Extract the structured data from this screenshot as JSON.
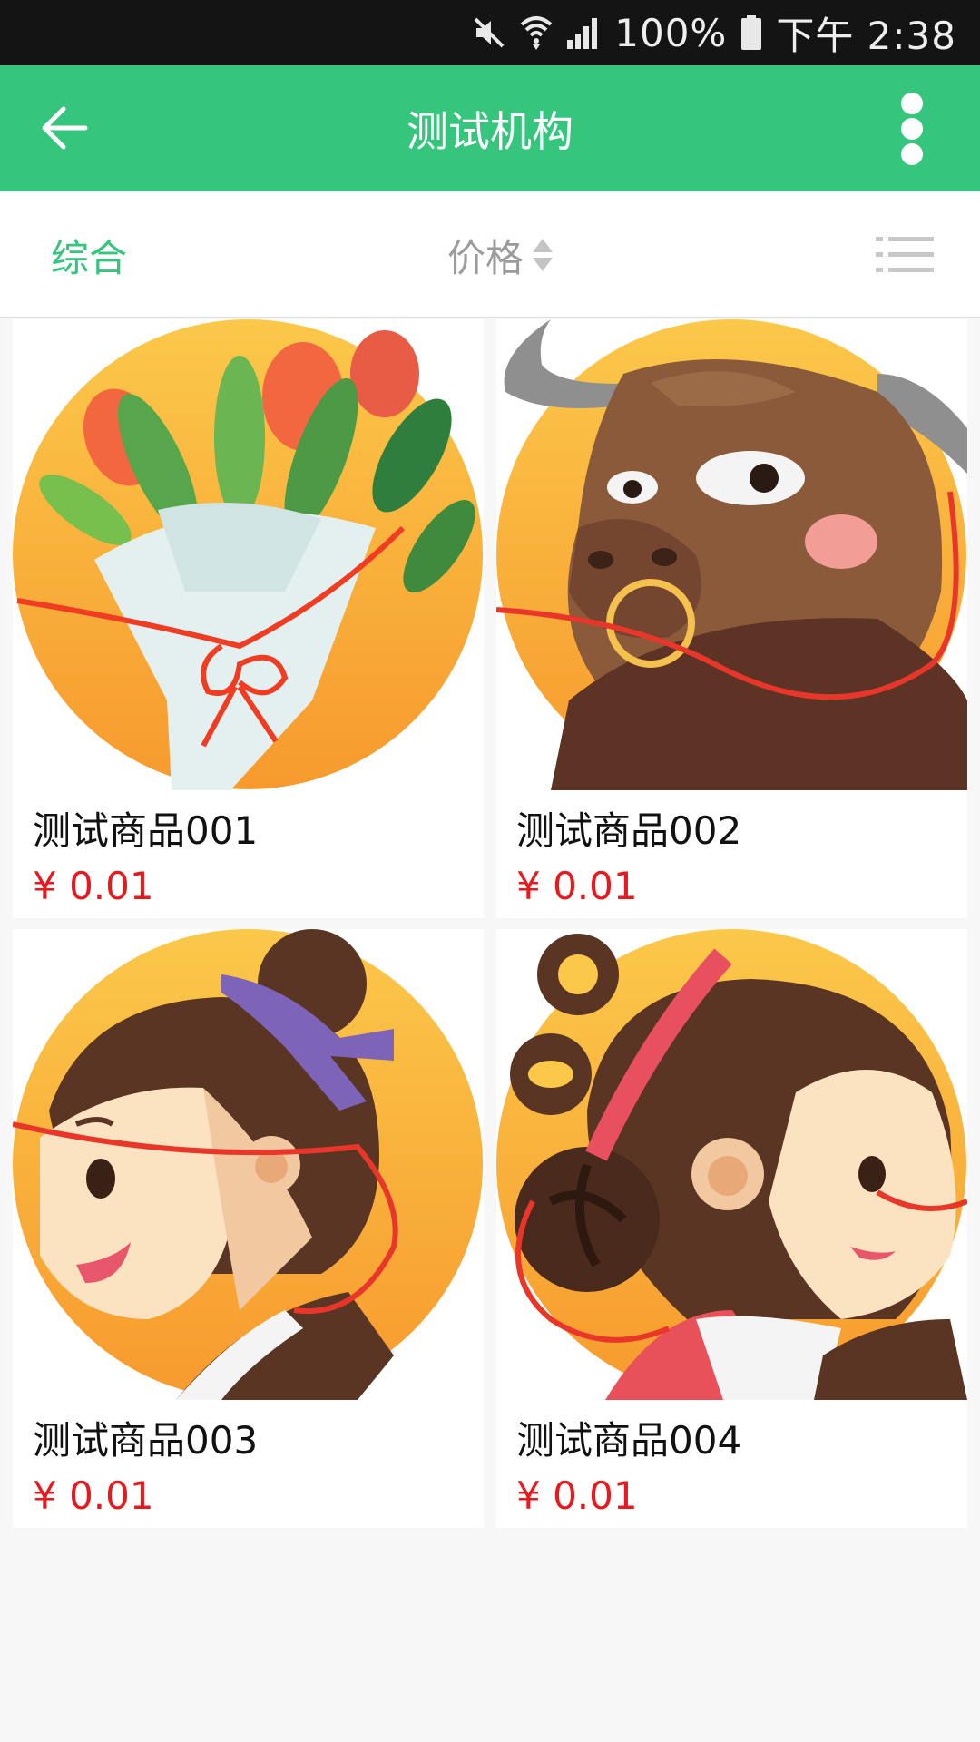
{
  "status_bar": {
    "battery": "100%",
    "time": "下午 2:38",
    "icons": [
      "mute-icon",
      "wifi-icon",
      "signal-icon",
      "battery-icon"
    ]
  },
  "app_bar": {
    "title": "测试机构",
    "back_icon": "arrow-left-icon",
    "menu_icon": "more-vertical-icon"
  },
  "sort_bar": {
    "comprehensive": "综合",
    "price": "价格",
    "price_icon": "sort-updown-icon",
    "view_icon": "list-view-icon"
  },
  "products": [
    {
      "name": "测试商品001",
      "price": "¥ 0.01",
      "image_icon": "flower-bouquet-illustration"
    },
    {
      "name": "测试商品002",
      "price": "¥ 0.01",
      "image_icon": "ox-illustration"
    },
    {
      "name": "测试商品003",
      "price": "¥ 0.01",
      "image_icon": "boy-illustration"
    },
    {
      "name": "测试商品004",
      "price": "¥ 0.01",
      "image_icon": "girl-illustration"
    }
  ],
  "colors": {
    "brand_green": "#35c57c",
    "price_red": "#e8191e",
    "status_bar_bg": "#141414",
    "inactive_gray": "#9b9b9b",
    "illustration_orange": "#f9b93f"
  }
}
